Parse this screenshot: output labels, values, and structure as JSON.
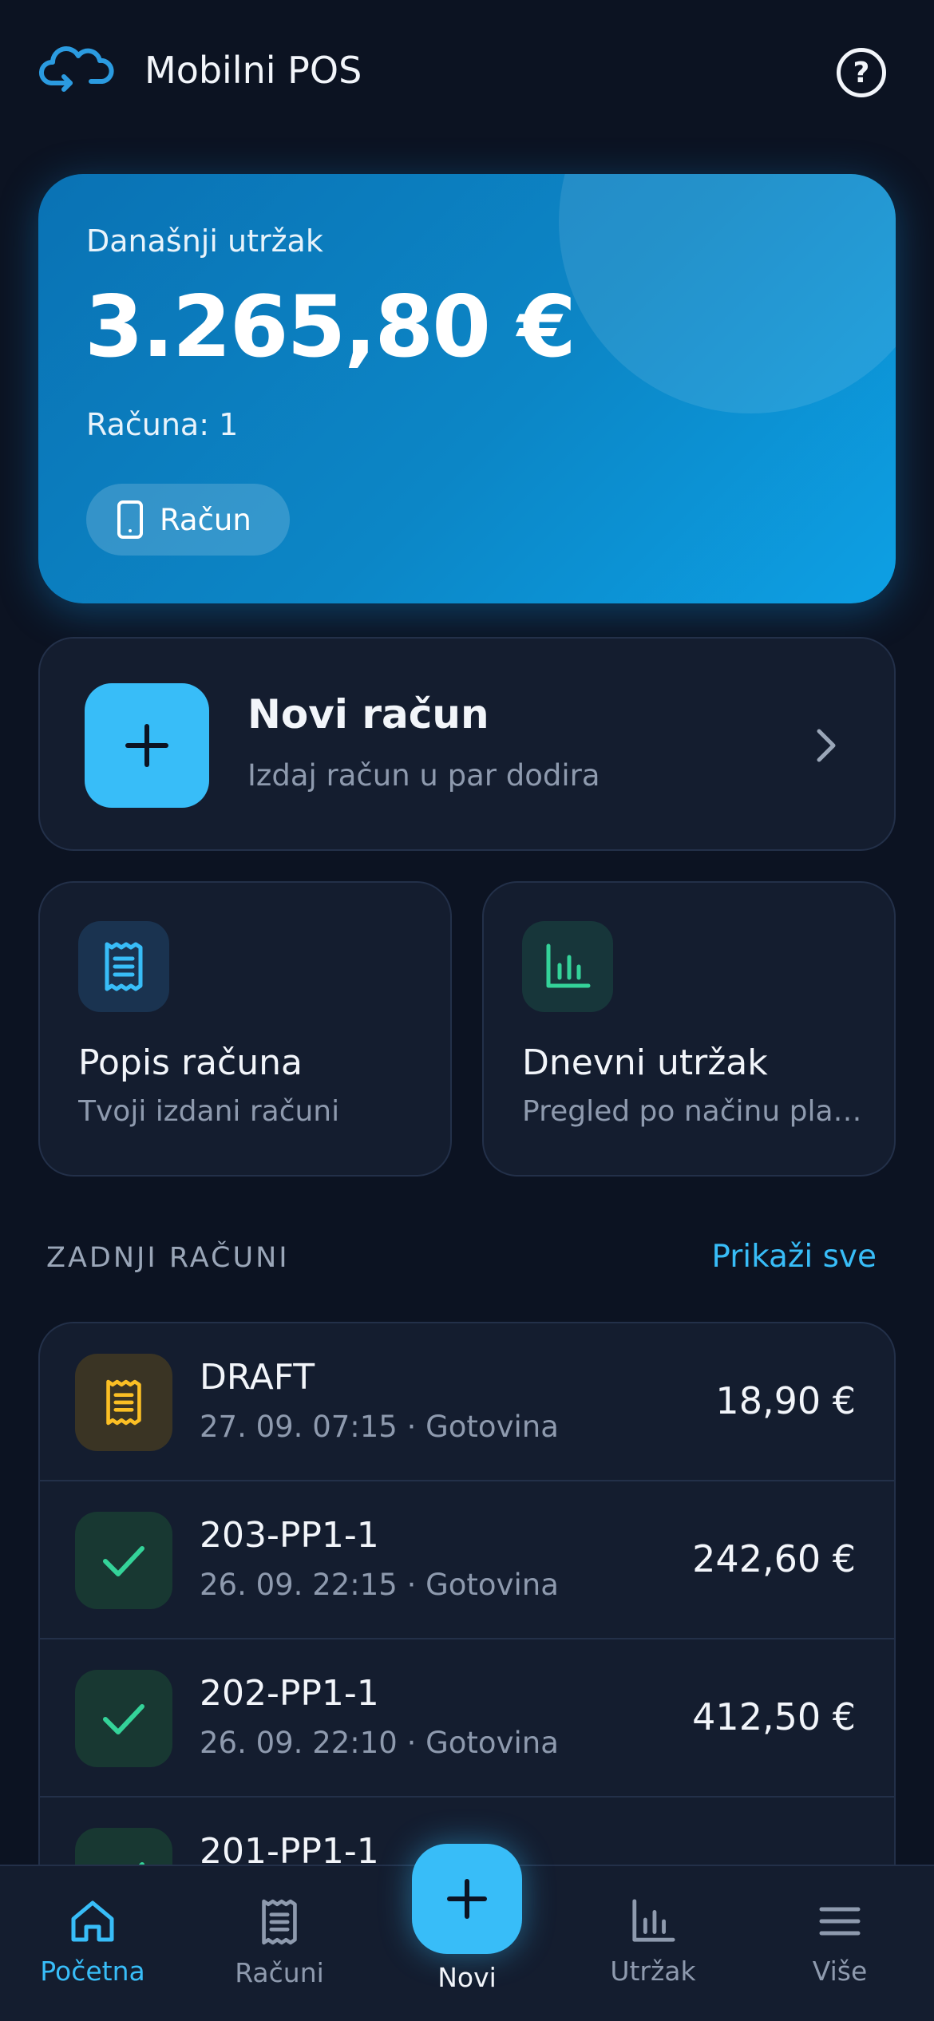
{
  "header": {
    "title": "Mobilni POS",
    "help_icon": "question-circle-icon",
    "help_glyph": "?"
  },
  "revenue": {
    "label": "Današnji utržak",
    "amount": "3.265,80 €",
    "count": "Računa: 1",
    "chip_label": "Račun",
    "chip_icon": "phone-icon"
  },
  "new_receipt": {
    "title": "Novi račun",
    "subtitle": "Izdaj račun u par dodira",
    "icon": "plus-icon"
  },
  "tiles": [
    {
      "title": "Popis računa",
      "subtitle": "Tvoji izdani računi",
      "icon": "receipt-icon",
      "accent": "#38bdf8",
      "bg": "#1a3350"
    },
    {
      "title": "Dnevni utržak",
      "subtitle": "Pregled po načinu plaćanja",
      "icon": "bar-chart-icon",
      "accent": "#34d399",
      "bg": "#17363a"
    }
  ],
  "recent": {
    "label": "ZADNJI RAČUNI",
    "link": "Prikaži sve",
    "items": [
      {
        "title": "DRAFT",
        "subtitle": "27. 09. 07:15 · Gotovina",
        "amount": "18,90 €",
        "status": "draft",
        "icon": "receipt-icon",
        "accent": "#fbbf24",
        "bg": "#3a3424"
      },
      {
        "title": "203-PP1-1",
        "subtitle": "26. 09. 22:15 · Gotovina",
        "amount": "242,60 €",
        "status": "paid",
        "icon": "check-icon",
        "accent": "#34d399",
        "bg": "#183832"
      },
      {
        "title": "202-PP1-1",
        "subtitle": "26. 09. 22:10 · Gotovina",
        "amount": "412,50 €",
        "status": "paid",
        "icon": "check-icon",
        "accent": "#34d399",
        "bg": "#183832"
      },
      {
        "title": "201-PP1-1",
        "subtitle": "",
        "amount": "",
        "status": "paid",
        "icon": "check-icon",
        "accent": "#34d399",
        "bg": "#183832"
      }
    ]
  },
  "nav": {
    "items": [
      {
        "label": "Početna",
        "icon": "home-icon",
        "active": true
      },
      {
        "label": "Računi",
        "icon": "receipt-icon",
        "active": false
      },
      {
        "label": "Novi",
        "icon": "plus-icon",
        "active": false
      },
      {
        "label": "Utržak",
        "icon": "bar-chart-icon",
        "active": false
      },
      {
        "label": "Više",
        "icon": "menu-icon",
        "active": false
      }
    ]
  },
  "colors": {
    "background": "#0c1322",
    "accent": "#38bdf8",
    "success": "#34d399",
    "warning": "#fbbf24",
    "card": "#141d2f"
  }
}
